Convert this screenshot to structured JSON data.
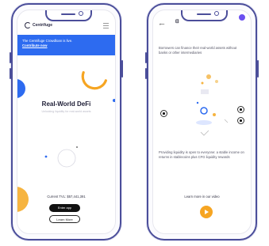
{
  "left_phone": {
    "logo_text": "Centrifuge",
    "banner": {
      "text": "The Centrifuge Crowdloan is live.",
      "link": "Contribute now"
    },
    "hero": {
      "title": "Real-World DeFi",
      "subtitle": "Unlocking liquidity for real-world assets"
    },
    "tvl_text": "Current TVL: $57,441,391",
    "buttons": {
      "enter": "Enter app",
      "learn": "Learn More"
    },
    "colors": {
      "banner": "#2d6bf0",
      "accent_orange": "#f6a522",
      "accent_blue": "#2d6bf0"
    }
  },
  "right_phone": {
    "top_line": "⟵",
    "logo_text": "ᗺ",
    "description": "Borrowers can finance their real-world assets without banks or other intermediaries",
    "description_2": "Providing liquidity is open to everyone: a stable income on returns in stablecoins plus CFG liquidity rewards",
    "video_label": "Learn more in our video",
    "icons": [
      "back-icon",
      "play-icon",
      "avatar-icon",
      "carousel-prev-icon",
      "carousel-next-icon"
    ]
  }
}
